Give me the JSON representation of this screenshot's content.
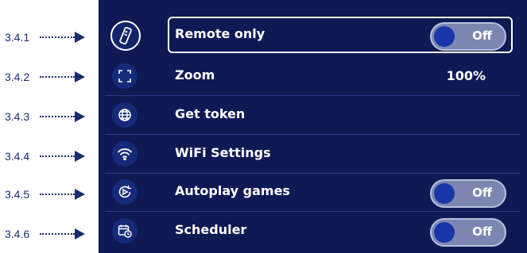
{
  "annotations": [
    "3.4.1",
    "3.4.2",
    "3.4.3",
    "3.4.4",
    "3.4.5",
    "3.4.6"
  ],
  "rows": [
    {
      "label": "Remote only",
      "value": "",
      "toggle": "Off",
      "icon": "remote-icon",
      "active": true
    },
    {
      "label": "Zoom",
      "value": "100%",
      "toggle": "",
      "icon": "zoom-frame-icon",
      "active": false
    },
    {
      "label": "Get token",
      "value": "",
      "toggle": "",
      "icon": "globe-icon",
      "active": false
    },
    {
      "label": "WiFi Settings",
      "value": "",
      "toggle": "",
      "icon": "wifi-icon",
      "active": false
    },
    {
      "label": "Autoplay games",
      "value": "",
      "toggle": "Off",
      "icon": "autoplay-icon",
      "active": false
    },
    {
      "label": "Scheduler",
      "value": "",
      "toggle": "Off",
      "icon": "scheduler-icon",
      "active": false
    }
  ],
  "colors": {
    "panel_bg": "#0f1a55",
    "accent": "#1936a8",
    "annotation": "#1a2d6e"
  }
}
